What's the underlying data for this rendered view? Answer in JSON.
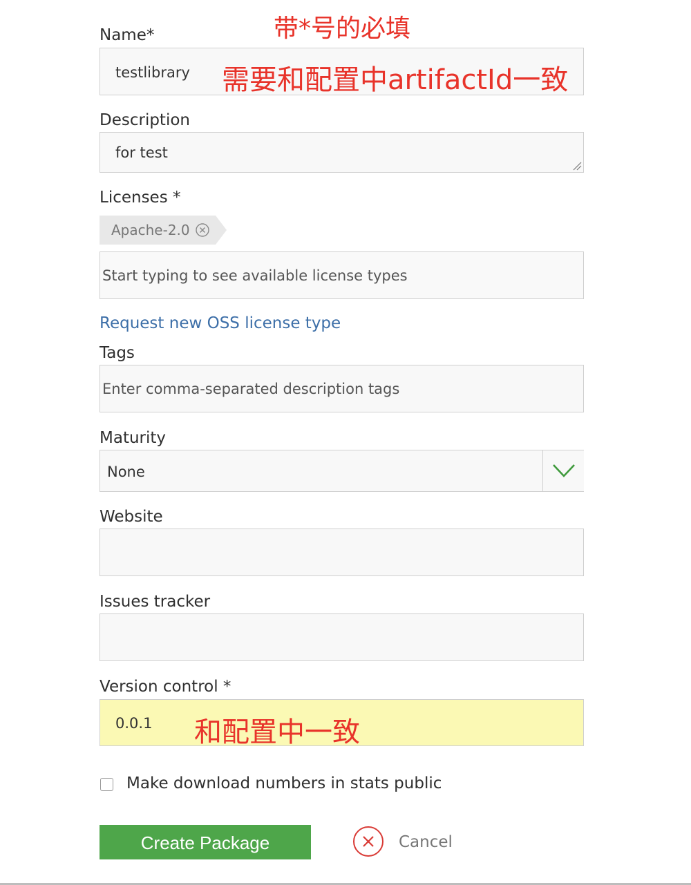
{
  "form": {
    "name": {
      "label": "Name*",
      "value": "testlibrary"
    },
    "description": {
      "label": "Description",
      "value": "for test"
    },
    "licenses": {
      "label": "Licenses *",
      "selected_tag": "Apache-2.0",
      "remove_icon": "close-circle-icon",
      "placeholder": "Start typing to see available license types",
      "request_link": "Request new OSS license type"
    },
    "tags": {
      "label": "Tags",
      "placeholder": "Enter comma-separated description tags"
    },
    "maturity": {
      "label": "Maturity",
      "value": "None",
      "dropdown_icon": "chevron-down-icon"
    },
    "website": {
      "label": "Website",
      "value": ""
    },
    "issues_tracker": {
      "label": "Issues tracker",
      "value": ""
    },
    "version_control": {
      "label": "Version control *",
      "value": "0.0.1"
    },
    "stats_public": {
      "label": "Make download numbers in stats public",
      "checked": false
    },
    "create_button": "Create Package",
    "cancel_button": "Cancel",
    "cancel_icon": "close-circle-icon"
  },
  "annotations": {
    "required_note": "带*号的必填",
    "name_note": "需要和配置中artifactId一致",
    "version_note": "和配置中一致"
  },
  "colors": {
    "annotation": "#e8332a",
    "link": "#3d6fa8",
    "primary_button": "#4ea64a",
    "cancel_icon": "#d93a35",
    "dropdown_chevron": "#3f9a3c",
    "highlight_field": "#fbf9b4"
  }
}
